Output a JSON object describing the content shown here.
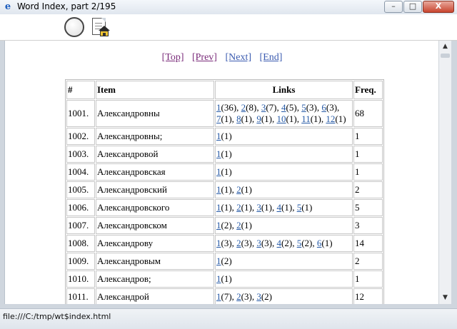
{
  "window": {
    "title": "Word Index, part 2/195",
    "app_icon": "e",
    "minimize": "–",
    "maximize": "□",
    "close": "X"
  },
  "toolbar": {
    "back_icon": "back-circle-icon",
    "home_icon": "home-document-icon"
  },
  "nav": {
    "top": "[Top]",
    "prev": "[Prev]",
    "next": "[Next]",
    "end": "[End]"
  },
  "table": {
    "headers": {
      "num": "#",
      "item": "Item",
      "links": "Links",
      "freq": "Freq."
    },
    "rows": [
      {
        "num": "1001.",
        "item": "Александровны",
        "freq": "68",
        "links": [
          {
            "l": "1",
            "c": "(36)"
          },
          {
            "l": "2",
            "c": "(8)"
          },
          {
            "l": "3",
            "c": "(7)"
          },
          {
            "l": "4",
            "c": "(5)"
          },
          {
            "l": "5",
            "c": "(3)"
          },
          {
            "l": "6",
            "c": "(3)"
          },
          {
            "l": "7",
            "c": "(1)"
          },
          {
            "l": "8",
            "c": "(1)"
          },
          {
            "l": "9",
            "c": "(1)"
          },
          {
            "l": "10",
            "c": "(1)"
          },
          {
            "l": "11",
            "c": "(1)"
          },
          {
            "l": "12",
            "c": "(1)"
          }
        ]
      },
      {
        "num": "1002.",
        "item": "Александровны;",
        "freq": "1",
        "links": [
          {
            "l": "1",
            "c": "(1)"
          }
        ]
      },
      {
        "num": "1003.",
        "item": "Александровой",
        "freq": "1",
        "links": [
          {
            "l": "1",
            "c": "(1)"
          }
        ]
      },
      {
        "num": "1004.",
        "item": "Александровская",
        "freq": "1",
        "links": [
          {
            "l": "1",
            "c": "(1)"
          }
        ]
      },
      {
        "num": "1005.",
        "item": "Александровский",
        "freq": "2",
        "links": [
          {
            "l": "1",
            "c": "(1)"
          },
          {
            "l": "2",
            "c": "(1)"
          }
        ]
      },
      {
        "num": "1006.",
        "item": "Александровского",
        "freq": "5",
        "links": [
          {
            "l": "1",
            "c": "(1)"
          },
          {
            "l": "2",
            "c": "(1)"
          },
          {
            "l": "3",
            "c": "(1)"
          },
          {
            "l": "4",
            "c": "(1)"
          },
          {
            "l": "5",
            "c": "(1)"
          }
        ]
      },
      {
        "num": "1007.",
        "item": "Александровском",
        "freq": "3",
        "links": [
          {
            "l": "1",
            "c": "(2)"
          },
          {
            "l": "2",
            "c": "(1)"
          }
        ]
      },
      {
        "num": "1008.",
        "item": "Александрову",
        "freq": "14",
        "links": [
          {
            "l": "1",
            "c": "(3)"
          },
          {
            "l": "2",
            "c": "(3)"
          },
          {
            "l": "3",
            "c": "(3)"
          },
          {
            "l": "4",
            "c": "(2)"
          },
          {
            "l": "5",
            "c": "(2)"
          },
          {
            "l": "6",
            "c": "(1)"
          }
        ]
      },
      {
        "num": "1009.",
        "item": "Александровым",
        "freq": "2",
        "links": [
          {
            "l": "1",
            "c": "(2)"
          }
        ]
      },
      {
        "num": "1010.",
        "item": "Александров;",
        "freq": "1",
        "links": [
          {
            "l": "1",
            "c": "(1)"
          }
        ]
      },
      {
        "num": "1011.",
        "item": "Александрой",
        "freq": "12",
        "links": [
          {
            "l": "1",
            "c": "(7)"
          },
          {
            "l": "2",
            "c": "(3)"
          },
          {
            "l": "3",
            "c": "(2)"
          }
        ]
      }
    ]
  },
  "scrollbar": {
    "up": "▲",
    "down": "▼"
  },
  "status": {
    "text": "file:///C:/tmp/wt$index.html"
  }
}
